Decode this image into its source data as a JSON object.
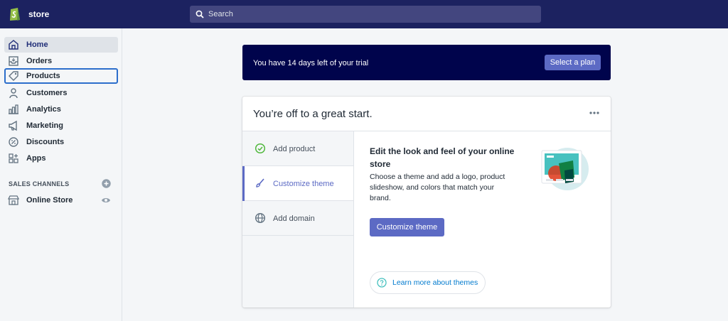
{
  "app": {
    "store_name": "store"
  },
  "search": {
    "placeholder": "Search"
  },
  "sidebar": {
    "items": [
      {
        "label": "Home",
        "icon": "home-icon",
        "state": "active"
      },
      {
        "label": "Orders",
        "icon": "orders-icon",
        "state": ""
      },
      {
        "label": "Products",
        "icon": "tag-icon",
        "state": "focused"
      },
      {
        "label": "Customers",
        "icon": "person-icon",
        "state": ""
      },
      {
        "label": "Analytics",
        "icon": "bar-chart-icon",
        "state": ""
      },
      {
        "label": "Marketing",
        "icon": "megaphone-icon",
        "state": ""
      },
      {
        "label": "Discounts",
        "icon": "discount-icon",
        "state": ""
      },
      {
        "label": "Apps",
        "icon": "apps-icon",
        "state": ""
      }
    ],
    "sales_channels_label": "SALES CHANNELS",
    "channels": [
      {
        "label": "Online Store",
        "icon": "storefront-icon"
      }
    ]
  },
  "trial": {
    "text": "You have 14 days left of your trial",
    "button": "Select a plan"
  },
  "setup_card": {
    "title": "You’re off to a great start.",
    "steps": [
      {
        "label": "Add product",
        "icon": "check-circle-icon",
        "status": "complete"
      },
      {
        "label": "Customize theme",
        "icon": "paintbrush-icon",
        "status": "selected"
      },
      {
        "label": "Add domain",
        "icon": "globe-icon",
        "status": ""
      }
    ],
    "detail": {
      "title": "Edit the look and feel of your online store",
      "description": "Choose a theme and add a logo, product slideshow, and colors that match your brand.",
      "button": "Customize theme",
      "learn_more": "Learn more about themes"
    }
  },
  "colors": {
    "topbar": "#1c2260",
    "trial_banner": "#00044c",
    "primary": "#5c6ac4",
    "link": "#007ace",
    "success": "#50b83c",
    "focus": "#2c6ecb"
  }
}
